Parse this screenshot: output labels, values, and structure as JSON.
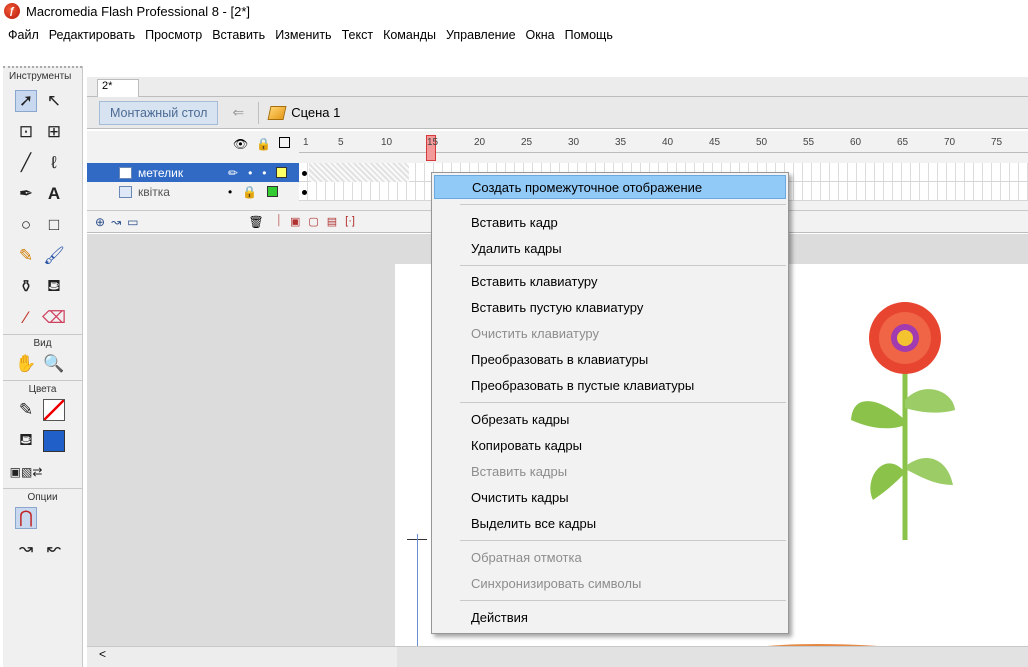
{
  "title": "Macromedia Flash Professional 8 - [2*]",
  "menu": [
    "Файл",
    "Редактировать",
    "Просмотр",
    "Вставить",
    "Изменить",
    "Текст",
    "Команды",
    "Управление",
    "Окна",
    "Помощь"
  ],
  "toolbox": {
    "header": "Инструменты",
    "view_label": "Вид",
    "colors_label": "Цвета",
    "options_label": "Опции"
  },
  "doc_tab": "2*",
  "edit_bar": {
    "stage_button": "Монтажный стол",
    "scene": "Сцена 1"
  },
  "timeline": {
    "ruler": [
      "1",
      "5",
      "10",
      "15",
      "20",
      "25",
      "30",
      "35",
      "40",
      "45",
      "50",
      "55",
      "60",
      "65",
      "70",
      "75"
    ],
    "current_frame": 14,
    "layers": [
      {
        "name": "метелик",
        "selected": true
      },
      {
        "name": "квітка",
        "selected": false
      }
    ]
  },
  "context_menu": {
    "items": [
      {
        "label": "Создать промежуточное отображение",
        "enabled": true,
        "highlighted": true
      },
      {
        "label": "Вставить кадр",
        "enabled": true
      },
      {
        "label": "Удалить кадры",
        "enabled": true
      },
      {
        "label": "Вставить клавиатуру",
        "enabled": true
      },
      {
        "label": "Вставить пустую клавиатуру",
        "enabled": true
      },
      {
        "label": "Очистить клавиатуру",
        "enabled": false
      },
      {
        "label": "Преобразовать в клавиатуры",
        "enabled": true
      },
      {
        "label": "Преобразовать в пустые клавиатуры",
        "enabled": true
      },
      {
        "label": "Обрезать кадры",
        "enabled": true
      },
      {
        "label": "Копировать кадры",
        "enabled": true
      },
      {
        "label": "Вставить кадры",
        "enabled": false
      },
      {
        "label": "Очистить кадры",
        "enabled": true
      },
      {
        "label": "Выделить все кадры",
        "enabled": true
      },
      {
        "label": "Обратная отмотка",
        "enabled": false
      },
      {
        "label": "Синхронизировать символы",
        "enabled": false
      },
      {
        "label": "Действия",
        "enabled": true
      }
    ]
  },
  "colors": {
    "selection": "#316ac5",
    "menu_highlight": "#91c9f7",
    "layer_color_1": "#ffff66",
    "layer_color_2": "#33cc33"
  }
}
